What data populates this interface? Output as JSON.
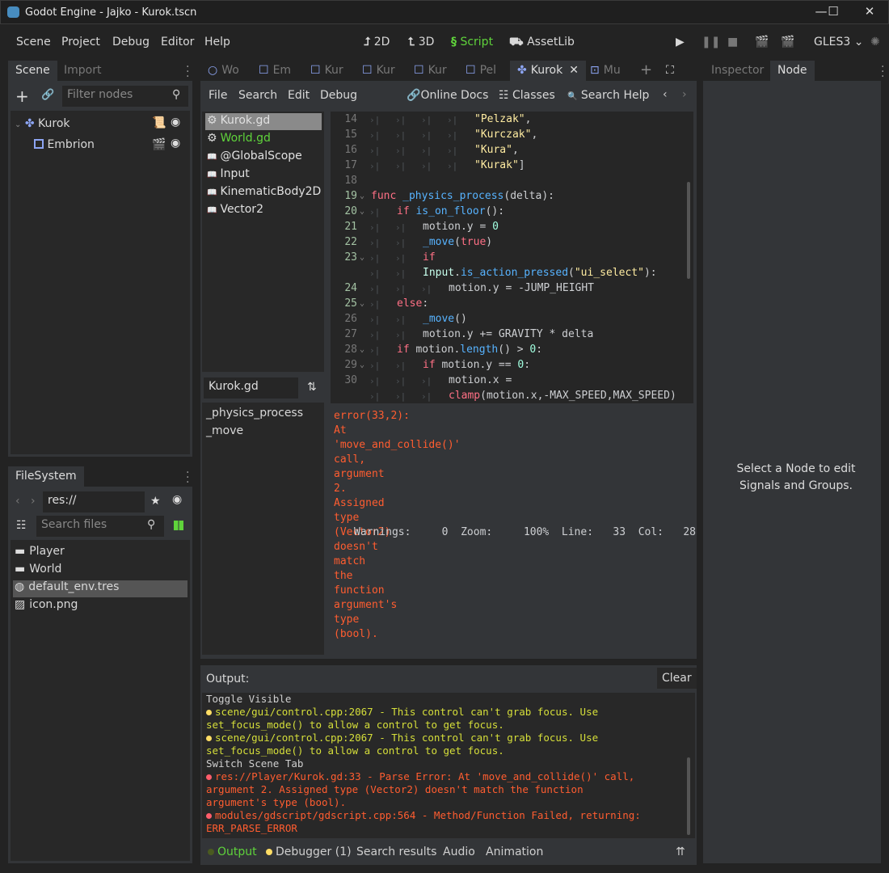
{
  "window": {
    "title": "Godot Engine - Jajko - Kurok.tscn",
    "minimize": "—",
    "maximize": "☐",
    "close": "✕"
  },
  "menu": [
    "Scene",
    "Project",
    "Debug",
    "Editor",
    "Help"
  ],
  "workspaces": [
    {
      "icon": "2d-icon",
      "glyph": "⮥",
      "label": "2D"
    },
    {
      "icon": "3d-icon",
      "glyph": "⮤",
      "label": "3D"
    },
    {
      "icon": "script-icon",
      "glyph": "§",
      "label": "Script"
    },
    {
      "icon": "assetlib-icon",
      "glyph": "🔒",
      "label": "AssetLib"
    }
  ],
  "colors": {
    "accent_green": "#5fd33b",
    "error": "#ff5d30",
    "warning": "#d6df3a",
    "node_blue": "#8da5f3"
  },
  "run": {
    "renderer": "GLES3"
  },
  "scene_dock": {
    "tabs": [
      "Scene",
      "Import"
    ],
    "filter_placeholder": "Filter nodes",
    "nodes": [
      {
        "name": "Kurok"
      },
      {
        "name": "Embrion"
      }
    ]
  },
  "filesystem": {
    "tab": "FileSystem",
    "path": "res://",
    "search_placeholder": "Search files",
    "items": [
      {
        "name": "Player",
        "icon": "folder-icon"
      },
      {
        "name": "World",
        "icon": "folder-icon"
      },
      {
        "name": "default_env.tres",
        "icon": "globe-icon",
        "selected": true
      },
      {
        "name": "icon.png",
        "icon": "image-icon"
      }
    ]
  },
  "scene_tabs": [
    {
      "label": "Wo",
      "active": false
    },
    {
      "label": "Em"
    },
    {
      "label": "Kur"
    },
    {
      "label": "Kur"
    },
    {
      "label": "Kur"
    },
    {
      "label": "Pel"
    },
    {
      "label": "Kurok",
      "active": true
    },
    {
      "label": "Mu"
    }
  ],
  "script_menu": [
    "File",
    "Search",
    "Edit",
    "Debug"
  ],
  "script_links": {
    "online_docs": "Online Docs",
    "classes": "Classes",
    "search_help": "Search Help"
  },
  "script_list": [
    {
      "name": "Kurok.gd",
      "type": "gear"
    },
    {
      "name": "World.gd",
      "type": "gear"
    },
    {
      "name": "@GlobalScope",
      "type": "doc"
    },
    {
      "name": "Input",
      "type": "doc"
    },
    {
      "name": "KinematicBody2D",
      "type": "doc"
    },
    {
      "name": "Vector2",
      "type": "doc"
    }
  ],
  "members_filter": "Kurok.gd",
  "members": [
    "_physics_process",
    "_move"
  ],
  "code": [
    {
      "n": "14",
      "tabs": 4,
      "seg": [
        [
          "\"Pelzak\"",
          "st"
        ],
        [
          ",",
          "tx"
        ]
      ]
    },
    {
      "n": "15",
      "tabs": 4,
      "seg": [
        [
          "\"Kurczak\"",
          "st"
        ],
        [
          ",",
          "tx"
        ]
      ]
    },
    {
      "n": "16",
      "tabs": 4,
      "seg": [
        [
          "\"Kura\"",
          "st"
        ],
        [
          ",",
          "tx"
        ]
      ]
    },
    {
      "n": "17",
      "tabs": 4,
      "seg": [
        [
          "\"Kurak\"",
          "st"
        ],
        [
          "]",
          "tx"
        ]
      ]
    },
    {
      "n": "18",
      "tabs": 0,
      "seg": []
    },
    {
      "n": "19",
      "fold": true,
      "mod": true,
      "tabs": 0,
      "seg": [
        [
          "func ",
          "kw"
        ],
        [
          "_physics_process",
          "fn"
        ],
        [
          "(delta):",
          "tx"
        ]
      ]
    },
    {
      "n": "20",
      "fold": true,
      "mod": true,
      "tabs": 1,
      "seg": [
        [
          "if ",
          "kw"
        ],
        [
          "is_on_floor",
          "fn"
        ],
        [
          "():",
          "tx"
        ]
      ]
    },
    {
      "n": "21",
      "mod": true,
      "tabs": 2,
      "seg": [
        [
          "motion.y = ",
          "tx"
        ],
        [
          "0",
          "nu"
        ]
      ]
    },
    {
      "n": "22",
      "mod": true,
      "tabs": 2,
      "seg": [
        [
          "_move",
          "fn"
        ],
        [
          "(",
          "tx"
        ],
        [
          "true",
          "kw"
        ],
        [
          ")",
          "tx"
        ]
      ]
    },
    {
      "n": "23",
      "fold": true,
      "mod": true,
      "tabs": 2,
      "seg": [
        [
          "if",
          "kw"
        ]
      ]
    },
    {
      "n": "",
      "tabs": 2,
      "seg": [
        [
          "Input",
          "cls"
        ],
        [
          ".",
          "tx"
        ],
        [
          "is_action_pressed",
          "fn"
        ],
        [
          "(",
          "tx"
        ],
        [
          "\"ui_select\"",
          "st"
        ],
        [
          "):",
          "tx"
        ]
      ]
    },
    {
      "n": "24",
      "mod": true,
      "tabs": 3,
      "seg": [
        [
          "motion.y = -JUMP_HEIGHT",
          "tx"
        ]
      ]
    },
    {
      "n": "25",
      "fold": true,
      "mod": true,
      "tabs": 1,
      "seg": [
        [
          "else",
          "kw"
        ],
        [
          ":",
          "tx"
        ]
      ]
    },
    {
      "n": "26",
      "tabs": 2,
      "seg": [
        [
          "_move",
          "fn"
        ],
        [
          "()",
          "tx"
        ]
      ]
    },
    {
      "n": "27",
      "tabs": 2,
      "seg": [
        [
          "motion.y += GRAVITY * delta",
          "tx"
        ]
      ]
    },
    {
      "n": "28",
      "fold": true,
      "tabs": 1,
      "seg": [
        [
          "if ",
          "kw"
        ],
        [
          "motion.",
          "tx"
        ],
        [
          "length",
          "fn"
        ],
        [
          "() > ",
          "tx"
        ],
        [
          "0",
          "nu"
        ],
        [
          ":",
          "tx"
        ]
      ]
    },
    {
      "n": "29",
      "fold": true,
      "tabs": 2,
      "seg": [
        [
          "if ",
          "kw"
        ],
        [
          "motion.y == ",
          "tx"
        ],
        [
          "0",
          "nu"
        ],
        [
          ":",
          "tx"
        ]
      ]
    },
    {
      "n": "30",
      "tabs": 3,
      "seg": [
        [
          "motion.x =",
          "tx"
        ]
      ]
    },
    {
      "n": "",
      "tabs": 3,
      "seg": [
        [
          "clamp",
          "kw"
        ],
        [
          "(motion.x,-MAX_SPEED,MAX_SPEED)",
          "tx"
        ]
      ]
    }
  ],
  "error_words": [
    "error(33,2):",
    "At",
    "'move_and_collide()'",
    "call,",
    "argument",
    "2.",
    "Assigned",
    "type",
    "(Vector2)",
    "doesn't",
    "match",
    "the",
    "function",
    "argument's",
    "type",
    "(bool)."
  ],
  "status": {
    "warnings_label": "Warnings:",
    "warnings": "0",
    "zoom_label": "Zoom:",
    "zoom": "100%",
    "line_label": "Line:",
    "line": "33",
    "col_label": "Col:",
    "col": "28"
  },
  "output": {
    "title": "Output:",
    "clear": "Clear",
    "lines": [
      {
        "t": "Toggle Visible",
        "k": "plain"
      },
      {
        "t": "scene/gui/control.cpp:2067 - This control can't grab focus. Use",
        "k": "warn",
        "b": "#ffdd65"
      },
      {
        "t": "set_focus_mode() to allow a control to get focus.",
        "k": "warn"
      },
      {
        "t": "scene/gui/control.cpp:2067 - This control can't grab focus. Use",
        "k": "warn",
        "b": "#ffdd65"
      },
      {
        "t": "set_focus_mode() to allow a control to get focus.",
        "k": "warn"
      },
      {
        "t": "Switch Scene Tab",
        "k": "plain"
      },
      {
        "t": "res://Player/Kurok.gd:33 - Parse Error: At 'move_and_collide()' call,",
        "k": "ored",
        "b": "#ff5d6b"
      },
      {
        "t": "argument 2. Assigned type (Vector2) doesn't match the function",
        "k": "ored"
      },
      {
        "t": "argument's type (bool).",
        "k": "ored"
      },
      {
        "t": "modules/gdscript/gdscript.cpp:564 - Method/Function Failed, returning:",
        "k": "ored",
        "b": "#ff5d6b"
      },
      {
        "t": "ERR_PARSE_ERROR",
        "k": "ored"
      }
    ]
  },
  "bottom_tabs": [
    "Output",
    "Debugger (1)",
    "Search results",
    "Audio",
    "Animation"
  ],
  "right_dock": {
    "tabs": [
      "Inspector",
      "Node"
    ],
    "message": "Select a Node to edit Signals and Groups."
  }
}
